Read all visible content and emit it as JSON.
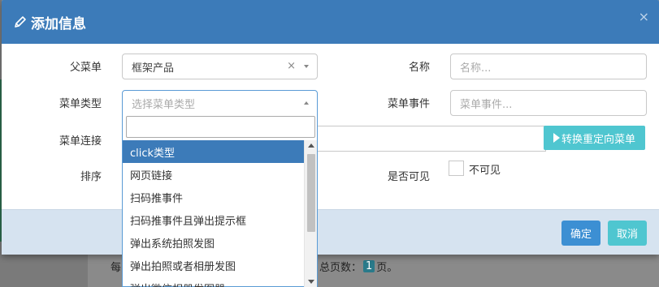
{
  "modal": {
    "title": "添加信息",
    "close_glyph": "×"
  },
  "form": {
    "parent_menu": {
      "label": "父菜单",
      "value": "框架产品",
      "clear_glyph": "×"
    },
    "name": {
      "label": "名称",
      "placeholder": "名称..."
    },
    "menu_type": {
      "label": "菜单类型",
      "placeholder": "选择菜单类型"
    },
    "menu_event": {
      "label": "菜单事件",
      "placeholder": "菜单事件..."
    },
    "menu_link": {
      "label": "菜单连接",
      "button_label": "转换重定向菜单"
    },
    "sort": {
      "label": "排序"
    },
    "visible": {
      "label": "是否可见",
      "checkbox_label": "不可见",
      "checked": false
    }
  },
  "dropdown": {
    "search_value": "",
    "options": [
      "click类型",
      "网页链接",
      "扫码推事件",
      "扫码推事件且弹出提示框",
      "弹出系统拍照发图",
      "弹出拍照或者相册发图",
      "弹出微信相册发图器"
    ],
    "highlighted_index": 0
  },
  "footer": {
    "ok_label": "确定",
    "cancel_label": "取消"
  },
  "background_page": {
    "footer_prefix": "每",
    "footer_suffix": "，总页数：",
    "page_count": "1",
    "page_unit": "页。"
  },
  "colors": {
    "header": "#3c7bb9",
    "primary_button": "#3c8fd3",
    "info_button": "#4fc6d0"
  }
}
